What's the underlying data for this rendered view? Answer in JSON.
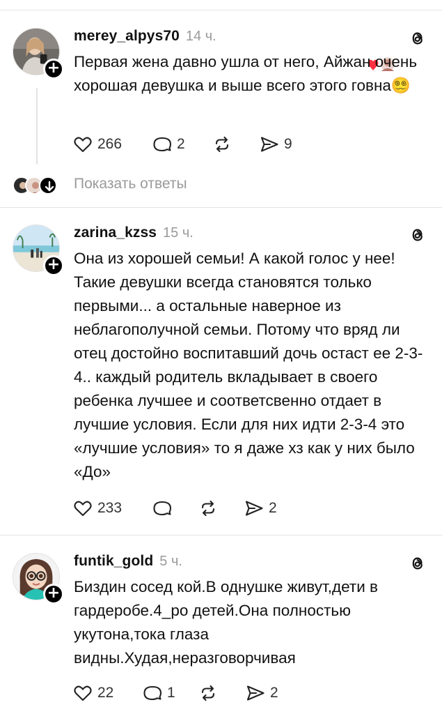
{
  "posts": [
    {
      "username": "merey_alpys70",
      "time": "14 ч.",
      "text": "Первая жена давно ушла от него, Айжан очень хорошая девушка и выше всего этого говна😵‍💫",
      "likes": "266",
      "comments": "2",
      "reposts": "",
      "shares": "9",
      "show_replies": "Показать ответы"
    },
    {
      "username": "zarina_kzss",
      "time": "15 ч.",
      "text": "Она из хорошей семьи! А какой голос у нее! Такие девушки всегда становятся только первыми... а остальные наверное из неблагополучной семьи. Потому что вряд ли отец достойно воспитавший дочь остаст ее 2-3-4.. каждый родитель вкладывает в своего ребенка лучшее и соответсвенно отдает в лучшие условия. Если для них идти 2-3-4 это «лучшие условия» то я даже хз как у них было «До»",
      "likes": "233",
      "comments": "",
      "reposts": "",
      "shares": "2"
    },
    {
      "username": "funtik_gold",
      "time": "5 ч.",
      "text": "Биздин сосед кой.В однушке живут,дети в гардеробе.4_ро детей.Она полностью укутона,тока глаза видны.Худая,неразговорчивая",
      "likes": "22",
      "comments": "1",
      "reposts": "",
      "shares": "2"
    }
  ],
  "icons": {
    "like": "heart-icon",
    "comment": "comment-icon",
    "repost": "repost-icon",
    "share": "share-icon",
    "threads": "threads-logo-icon",
    "follow": "plus-icon",
    "liked_badge": "heart-icon"
  },
  "colors": {
    "text": "#111111",
    "muted": "#9a9a9a",
    "divider": "#e3e3e3",
    "liked_heart": "#ff3040"
  }
}
